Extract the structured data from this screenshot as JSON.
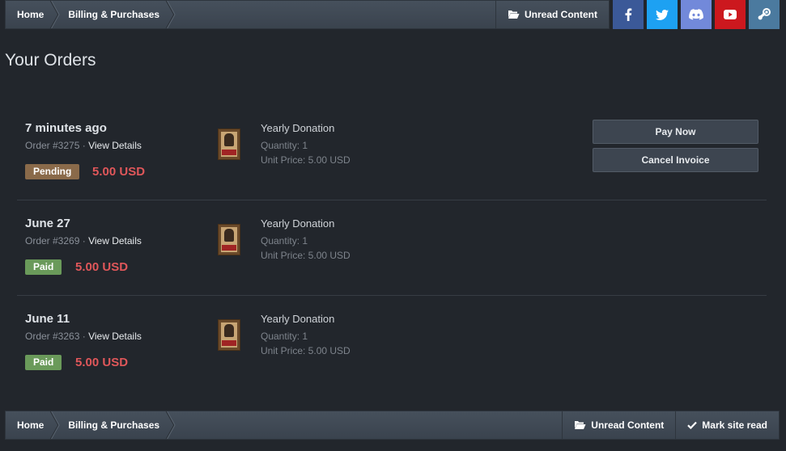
{
  "breadcrumb": {
    "home": "Home",
    "section": "Billing & Purchases"
  },
  "top_bar": {
    "unread": "Unread Content"
  },
  "social": [
    {
      "name": "facebook",
      "color": "#3b5998"
    },
    {
      "name": "twitter",
      "color": "#1da1f2"
    },
    {
      "name": "discord",
      "color": "#7289da"
    },
    {
      "name": "youtube",
      "color": "#cc181e"
    },
    {
      "name": "steam",
      "color": "#4b7a9f"
    }
  ],
  "page": {
    "title": "Your Orders"
  },
  "orders": [
    {
      "date": "7 minutes ago",
      "order_label": "Order #3275",
      "sep": " · ",
      "details": "View Details",
      "status": "Pending",
      "amount": "5.00 USD",
      "item": "Yearly Donation",
      "quantity": "Quantity: 1",
      "unit_price": "Unit Price: 5.00 USD",
      "actions": {
        "pay": "Pay Now",
        "cancel": "Cancel Invoice"
      }
    },
    {
      "date": "June 27",
      "order_label": "Order #3269",
      "sep": " · ",
      "details": "View Details",
      "status": "Paid",
      "amount": "5.00 USD",
      "item": "Yearly Donation",
      "quantity": "Quantity: 1",
      "unit_price": "Unit Price: 5.00 USD"
    },
    {
      "date": "June 11",
      "order_label": "Order #3263",
      "sep": " · ",
      "details": "View Details",
      "status": "Paid",
      "amount": "5.00 USD",
      "item": "Yearly Donation",
      "quantity": "Quantity: 1",
      "unit_price": "Unit Price: 5.00 USD"
    }
  ],
  "bottom_bar": {
    "unread": "Unread Content",
    "mark_read": "Mark site read"
  },
  "colors": {
    "pending": "#8a6a4a",
    "paid": "#6a9a5a",
    "price": "#e0575a"
  }
}
